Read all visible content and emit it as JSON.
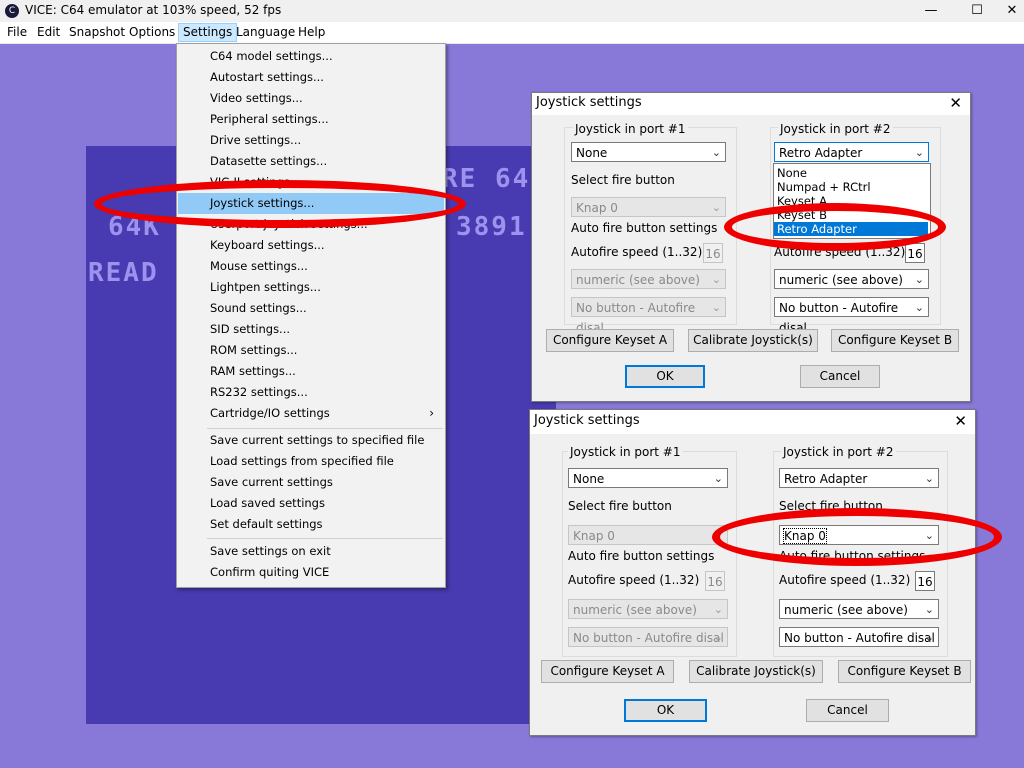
{
  "window": {
    "title": "VICE: C64 emulator at 103% speed, 52 fps",
    "icon": "c64-logo-icon",
    "minimize": "—",
    "maximize": "☐",
    "close": "✕"
  },
  "menubar": [
    "File",
    "Edit",
    "Snapshot",
    "Options",
    "Settings",
    "Language",
    "Help"
  ],
  "c64_screen": {
    "line1": "RE 64",
    "line2": "64K",
    "line3": "3891",
    "line4": "READ"
  },
  "settings_menu": {
    "items": [
      "C64 model settings...",
      "Autostart settings...",
      "Video settings...",
      "Peripheral settings...",
      "Drive settings...",
      "Datasette settings...",
      "VIC-II settings...",
      "Joystick settings...",
      "Userport joystick settings...",
      "Keyboard settings...",
      "Mouse settings...",
      "Lightpen settings...",
      "Sound settings...",
      "SID settings...",
      "ROM settings...",
      "RAM settings...",
      "RS232 settings...",
      "Cartridge/IO settings",
      "Save current settings to specified file",
      "Load settings from specified file",
      "Save current settings",
      "Load saved settings",
      "Set default settings",
      "Save settings on exit",
      "Confirm quiting VICE"
    ],
    "submenu_arrow": "›",
    "highlighted": "Joystick settings..."
  },
  "dialog1": {
    "title": "Joystick settings",
    "close": "✕",
    "port1_label": "Joystick in port #1",
    "port2_label": "Joystick in port #2",
    "port1_value": "None",
    "port2_value": "Retro Adapter",
    "fire_label": "Select fire button",
    "fire_value": "Knap 0",
    "autofire_label": "Auto fire button settings",
    "speed_label": "Autofire speed (1..32)",
    "speed_port1": "16",
    "speed_port2": "16",
    "mode_value": "numeric (see above)",
    "button_value": "No button - Autofire disal",
    "dropdown_options": [
      "None",
      "Numpad + RCtrl",
      "Keyset A",
      "Keyset B",
      "Retro Adapter"
    ],
    "btn_keyset_a": "Configure Keyset A",
    "btn_calibrate": "Calibrate Joystick(s)",
    "btn_keyset_b": "Configure Keyset B",
    "btn_ok": "OK",
    "btn_cancel": "Cancel"
  },
  "dialog2": {
    "title": "Joystick settings",
    "close": "✕",
    "port1_label": "Joystick in port #1",
    "port2_label": "Joystick in port #2",
    "port1_value": "None",
    "port2_value": "Retro Adapter",
    "fire_label": "Select fire button",
    "fire_value": "Knap 0",
    "autofire_label": "Auto fire button settings",
    "speed_label": "Autofire speed (1..32)",
    "speed_port1": "16",
    "speed_port2": "16",
    "mode_value": "numeric (see above)",
    "button_value": "No button - Autofire disal",
    "btn_keyset_a": "Configure Keyset A",
    "btn_calibrate": "Calibrate Joystick(s)",
    "btn_keyset_b": "Configure Keyset B",
    "btn_ok": "OK",
    "btn_cancel": "Cancel"
  },
  "colors": {
    "c64_border": "#8878d8",
    "c64_screen": "#483ab0",
    "c64_text": "#9e92ee",
    "menu_highlight": "#91c9f7",
    "annotation_red": "#ee0000",
    "selection_blue": "#0078d7"
  }
}
